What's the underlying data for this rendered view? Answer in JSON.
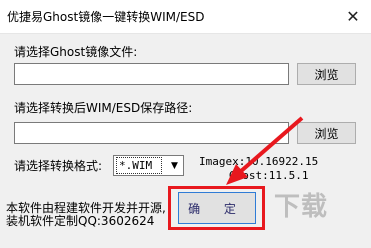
{
  "window": {
    "title": "优捷易Ghost镜像一键转换WIM/ESD",
    "close_glyph": "✕"
  },
  "source": {
    "label": "请选择Ghost镜像文件:",
    "value": "",
    "browse_label": "浏览"
  },
  "target": {
    "label": "请选择转换后WIM/ESD保存路径:",
    "value": "",
    "browse_label": "浏览"
  },
  "format": {
    "label": "请选择转换格式:",
    "selected": "*.WIM",
    "arrow_glyph": "▼"
  },
  "versions": {
    "imagex": "Imagex:10.16922.15",
    "ghost": "Ghost:11.5.1"
  },
  "footer": {
    "line1": "本软件由程建软件开发并开源,",
    "line2": "装机软件定制QQ:3602624"
  },
  "confirm_label": "确 定",
  "watermark_text": "下载",
  "annotation_color": "#e8181e"
}
